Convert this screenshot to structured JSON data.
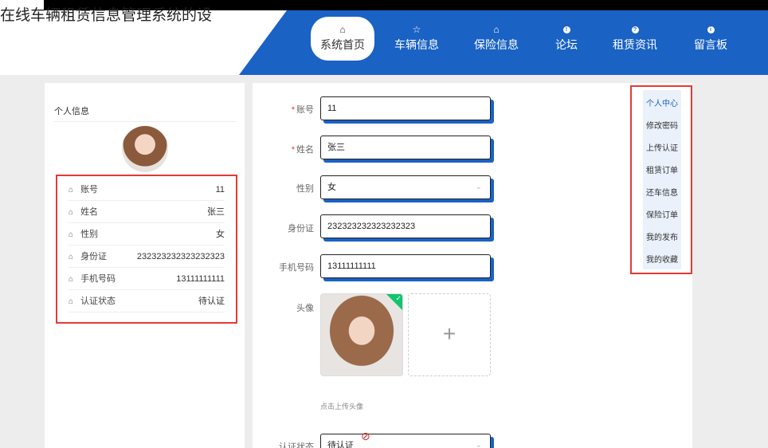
{
  "site": {
    "title": "在线车辆租赁信息管理系统的设"
  },
  "nav": {
    "items": [
      {
        "label": "系统首页",
        "icon": "home-icon",
        "glyph": "⌂"
      },
      {
        "label": "车辆信息",
        "icon": "star-icon",
        "glyph": "☆"
      },
      {
        "label": "保险信息",
        "icon": "house-icon",
        "glyph": "⌂"
      },
      {
        "label": "论坛",
        "icon": "exclaim-icon",
        "glyph": "!"
      },
      {
        "label": "租赁资讯",
        "icon": "question-icon",
        "glyph": "?"
      },
      {
        "label": "留言板",
        "icon": "info-icon",
        "glyph": "i"
      }
    ]
  },
  "profile": {
    "title": "个人信息",
    "rows": [
      {
        "label": "账号",
        "value": "11"
      },
      {
        "label": "姓名",
        "value": "张三"
      },
      {
        "label": "性别",
        "value": "女"
      },
      {
        "label": "身份证",
        "value": "232323232323232323"
      },
      {
        "label": "手机号码",
        "value": "13111111111"
      },
      {
        "label": "认证状态",
        "value": "待认证"
      }
    ]
  },
  "form": {
    "account_label": "账号",
    "account_value": "11",
    "name_label": "姓名",
    "name_value": "张三",
    "gender_label": "性别",
    "gender_value": "女",
    "idcard_label": "身份证",
    "idcard_value": "232323232323232323",
    "phone_label": "手机号码",
    "phone_value": "13111111111",
    "avatar_label": "头像",
    "upload_plus": "+",
    "upload_hint": "点击上传头像",
    "status_label": "认证状态",
    "status_value": "待认证"
  },
  "side_menu": {
    "items": [
      "个人中心",
      "修改密码",
      "上传认证",
      "租赁订单",
      "还车信息",
      "保险订单",
      "我的发布",
      "我的收藏"
    ]
  },
  "colors": {
    "accent": "#1a62c4",
    "highlight": "#e53935",
    "success": "#13c46d"
  }
}
